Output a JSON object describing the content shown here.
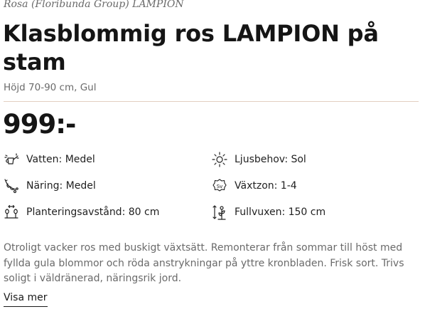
{
  "product": {
    "latin_name": "Rosa (Floribunda Group) LAMPION",
    "title": "Klasblommig ros LAMPION på stam",
    "subtitle": "Höjd 70-90 cm, Gul",
    "price": "999:-"
  },
  "attributes": [
    {
      "label": "Vatten: Medel",
      "icon": "watering-can-icon"
    },
    {
      "label": "Ljusbehov: Sol",
      "icon": "sun-icon"
    },
    {
      "label": "Näring: Medel",
      "icon": "fertilizer-icon"
    },
    {
      "label": "Växtzon: 1-4",
      "icon": "zone-badge-icon"
    },
    {
      "label": "Planteringsavstånd: 80 cm",
      "icon": "planting-distance-icon"
    },
    {
      "label": "Fullvuxen: 150 cm",
      "icon": "height-icon"
    }
  ],
  "description": "Otroligt vacker ros med buskigt växtsätt. Remonterar från sommar till höst med fyllda gula blommor och röda anstrykningar på yttre kronbladen. Frisk sort. Trivs soligt i väldränerad, näringsrik jord.",
  "show_more_label": "Visa mer",
  "zone_badge_text": "Sv"
}
